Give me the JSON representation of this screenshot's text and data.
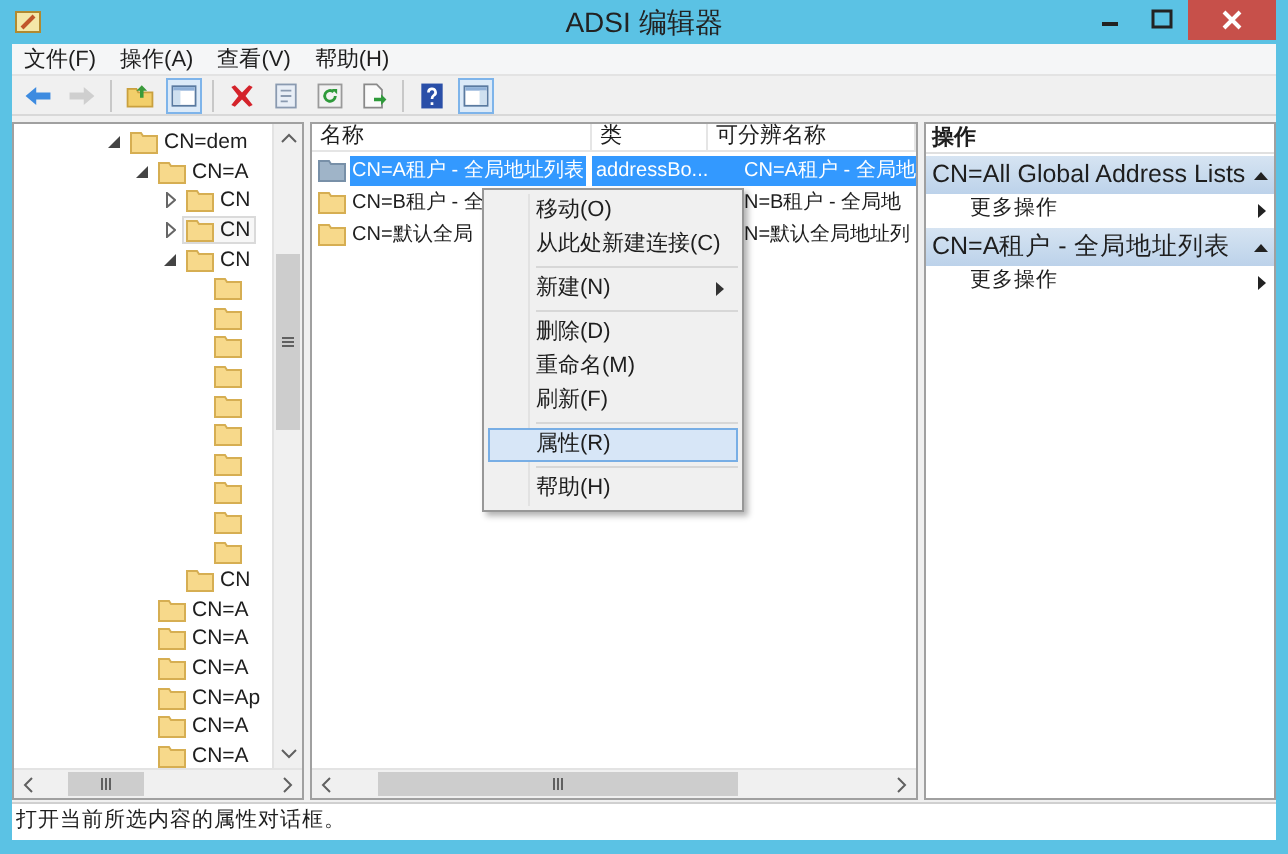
{
  "window": {
    "title": "ADSI 编辑器"
  },
  "menu": [
    "文件(F)",
    "操作(A)",
    "查看(V)",
    "帮助(H)"
  ],
  "toolbar": [
    {
      "kind": "back",
      "disabled": false
    },
    {
      "kind": "forward",
      "disabled": true
    },
    {
      "kind": "separator"
    },
    {
      "kind": "up",
      "disabled": false
    },
    {
      "kind": "toggle-tree",
      "pressed": true
    },
    {
      "kind": "separator"
    },
    {
      "kind": "delete",
      "disabled": false
    },
    {
      "kind": "properties",
      "disabled": false
    },
    {
      "kind": "refresh",
      "disabled": false
    },
    {
      "kind": "export",
      "disabled": false
    },
    {
      "kind": "separator"
    },
    {
      "kind": "help",
      "disabled": false
    },
    {
      "kind": "toggle-actions",
      "pressed": true
    }
  ],
  "tree": [
    {
      "label": "CN=dem",
      "expanded": true,
      "selected": false,
      "children": [
        {
          "label": "CN=A",
          "expanded": true,
          "selected": false,
          "children": [
            {
              "label": "CN",
              "expanded": false,
              "selected": false
            },
            {
              "label": "CN",
              "expanded": false,
              "selected": true
            },
            {
              "label": "CN",
              "expanded": true,
              "selected": false,
              "children": [
                {
                  "selected": false
                },
                {
                  "selected": false
                },
                {
                  "selected": false
                },
                {
                  "selected": false
                },
                {
                  "selected": false
                },
                {
                  "selected": false
                },
                {
                  "selected": false
                },
                {
                  "selected": false
                },
                {
                  "selected": false
                },
                {
                  "selected": false
                }
              ]
            },
            {
              "label": "CN",
              "selected": false
            }
          ]
        },
        {
          "label": "CN=A",
          "selected": false
        },
        {
          "label": "CN=A",
          "selected": false
        },
        {
          "label": "CN=A",
          "selected": false
        },
        {
          "label": "CN=Ap",
          "selected": false
        },
        {
          "label": "CN=A",
          "selected": false
        },
        {
          "label": "CN=A",
          "selected": false
        }
      ]
    }
  ],
  "list": {
    "columns": [
      "名称",
      "类",
      "可分辨名称"
    ],
    "rows": [
      {
        "kind": "address-list",
        "selected": true,
        "cells": [
          "CN=A租户 - 全局地址列表",
          "addressBo...",
          "CN=A租户 - 全局地"
        ]
      },
      {
        "kind": "folder",
        "selected": false,
        "cells": [
          "CN=B租户 - 全",
          "",
          "N=B租户 - 全局地"
        ]
      },
      {
        "kind": "folder",
        "selected": false,
        "cells": [
          "CN=默认全局",
          "",
          "N=默认全局地址列"
        ]
      }
    ]
  },
  "context_menu": [
    {
      "kind": "item",
      "label": "移动(O)",
      "selected": false
    },
    {
      "kind": "item",
      "label": "从此处新建连接(C)",
      "selected": false
    },
    {
      "kind": "separator"
    },
    {
      "kind": "submenu",
      "label": "新建(N)",
      "selected": false
    },
    {
      "kind": "separator"
    },
    {
      "kind": "item",
      "label": "删除(D)",
      "selected": false
    },
    {
      "kind": "item",
      "label": "重命名(M)",
      "selected": false
    },
    {
      "kind": "item",
      "label": "刷新(F)",
      "selected": false
    },
    {
      "kind": "separator"
    },
    {
      "kind": "item",
      "label": "属性(R)",
      "selected": true
    },
    {
      "kind": "separator"
    },
    {
      "kind": "item",
      "label": "帮助(H)",
      "selected": false
    }
  ],
  "actions": {
    "title": "操作",
    "sections": [
      {
        "title": "CN=All Global Address Lists",
        "expanded": true,
        "items": [
          "更多操作"
        ]
      },
      {
        "title": "CN=A租户 - 全局地址列表",
        "expanded": true,
        "items": [
          "更多操作"
        ]
      }
    ]
  },
  "status_bar": "打开当前所选内容的属性对话框。"
}
